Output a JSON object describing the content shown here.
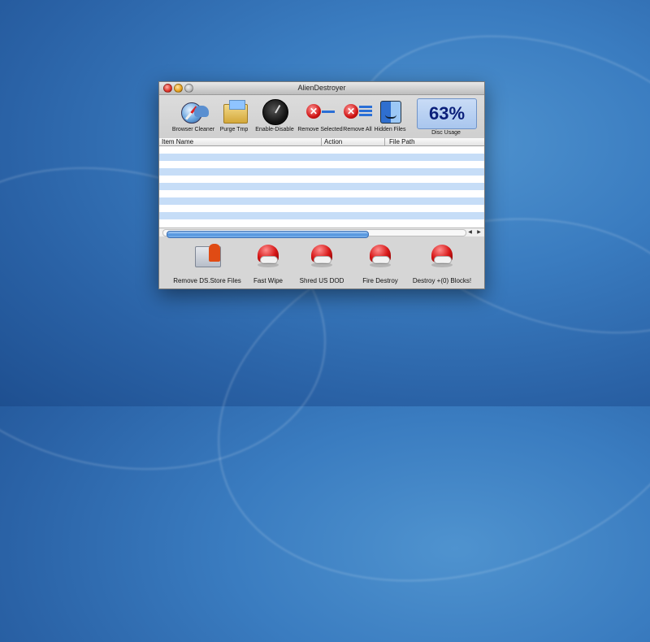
{
  "window": {
    "title": "AlienDestroyer"
  },
  "toolbar": {
    "items": [
      {
        "label": "Browser Cleaner",
        "icon": "browser-cleaner-icon"
      },
      {
        "label": "Purge Tmp",
        "icon": "purge-tmp-icon"
      },
      {
        "label": "Enable-Disable",
        "icon": "enable-disable-icon"
      },
      {
        "label": "Remove Selected",
        "icon": "remove-selected-icon"
      },
      {
        "label": "Remove All",
        "icon": "remove-all-icon"
      },
      {
        "label": "Hidden Files",
        "icon": "finder-icon"
      }
    ],
    "disc_usage": {
      "value": "63%",
      "label": "Disc Usage"
    }
  },
  "table": {
    "columns": [
      "Item Name",
      "Action",
      "File Path"
    ]
  },
  "scrollbar": {
    "position": 0.7
  },
  "actions": {
    "items": [
      {
        "label": "Remove DS.Store Files",
        "icon": "ds-store-icon"
      },
      {
        "label": "Fast Wipe",
        "icon": "red-helmet-icon"
      },
      {
        "label": "Shred US DOD",
        "icon": "red-helmet-icon"
      },
      {
        "label": "Fire Destroy",
        "icon": "red-helmet-icon"
      },
      {
        "label": "Destroy +(0) Blocks!",
        "icon": "red-helmet-icon"
      }
    ]
  }
}
